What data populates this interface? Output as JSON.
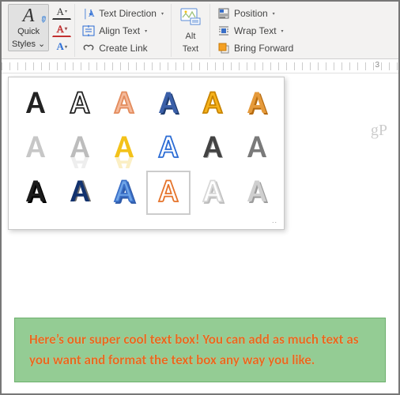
{
  "ribbon": {
    "quickStyles": {
      "label1": "Quick",
      "label2": "Styles",
      "dd": "⌄"
    },
    "miniA1": "A",
    "miniA2": "A",
    "miniA3": "A",
    "textDirection": "Text Direction",
    "alignText": "Align Text",
    "createLink": "Create Link",
    "altText": {
      "label1": "Alt",
      "label2": "Text"
    },
    "position": "Position",
    "wrapText": "Wrap Text",
    "bringForward": "Bring Forward"
  },
  "ruler": {
    "mark3": "3"
  },
  "watermark": "gP",
  "textbox": "Here’s our super cool text box! You can add as much text as you want and format the text box any way you like.",
  "gallery": {
    "selectedIndex": 15,
    "styles": [
      {
        "fill": "#222",
        "stroke": "none",
        "weight": "900"
      },
      {
        "fill": "none",
        "stroke": "#222",
        "weight": "900"
      },
      {
        "fill": "#f4b99a",
        "stroke": "#e38b5c",
        "weight": "900"
      },
      {
        "fill": "#3a5fa8",
        "stroke": "none",
        "weight": "900",
        "shadow": "2,2,#1f3c70"
      },
      {
        "fill": "#f6b21b",
        "stroke": "#c88400",
        "weight": "900"
      },
      {
        "fill": "#e59a3b",
        "stroke": "none",
        "weight": "900",
        "shadow": "2,2,#b56a0e"
      },
      {
        "fill": "#c7c7c7",
        "stroke": "none",
        "weight": "900"
      },
      {
        "fill": "#bdbdbd",
        "stroke": "none",
        "weight": "900",
        "reflect": true
      },
      {
        "fill": "#f3c21a",
        "stroke": "none",
        "weight": "900",
        "reflect": true
      },
      {
        "fill": "none",
        "stroke": "#2a6bd4",
        "weight": "900"
      },
      {
        "fill": "#434343",
        "stroke": "none",
        "weight": "900",
        "shadow": "1,1,#a6a6a6"
      },
      {
        "fill": "#7a7a7a",
        "stroke": "none",
        "weight": "900"
      },
      {
        "fill": "#1b1b1b",
        "stroke": "none",
        "weight": "900",
        "shadow": "2,2,#000"
      },
      {
        "fill": "#12326e",
        "stroke": "none",
        "weight": "900",
        "shadow": "2,0,#6a6a6a"
      },
      {
        "fill": "#6ea3e6",
        "stroke": "#3a6fc7",
        "weight": "900",
        "shadow": "2,2,#2e5aa8"
      },
      {
        "fill": "none",
        "stroke": "#e5732a",
        "weight": "900"
      },
      {
        "fill": "#fff",
        "stroke": "#d8d8d8",
        "weight": "900",
        "shadow": "2,2,#bcbcbc"
      },
      {
        "fill": "#cfcfcf",
        "stroke": "none",
        "weight": "900",
        "shadow": "2,2,#9c9c9c"
      }
    ]
  }
}
